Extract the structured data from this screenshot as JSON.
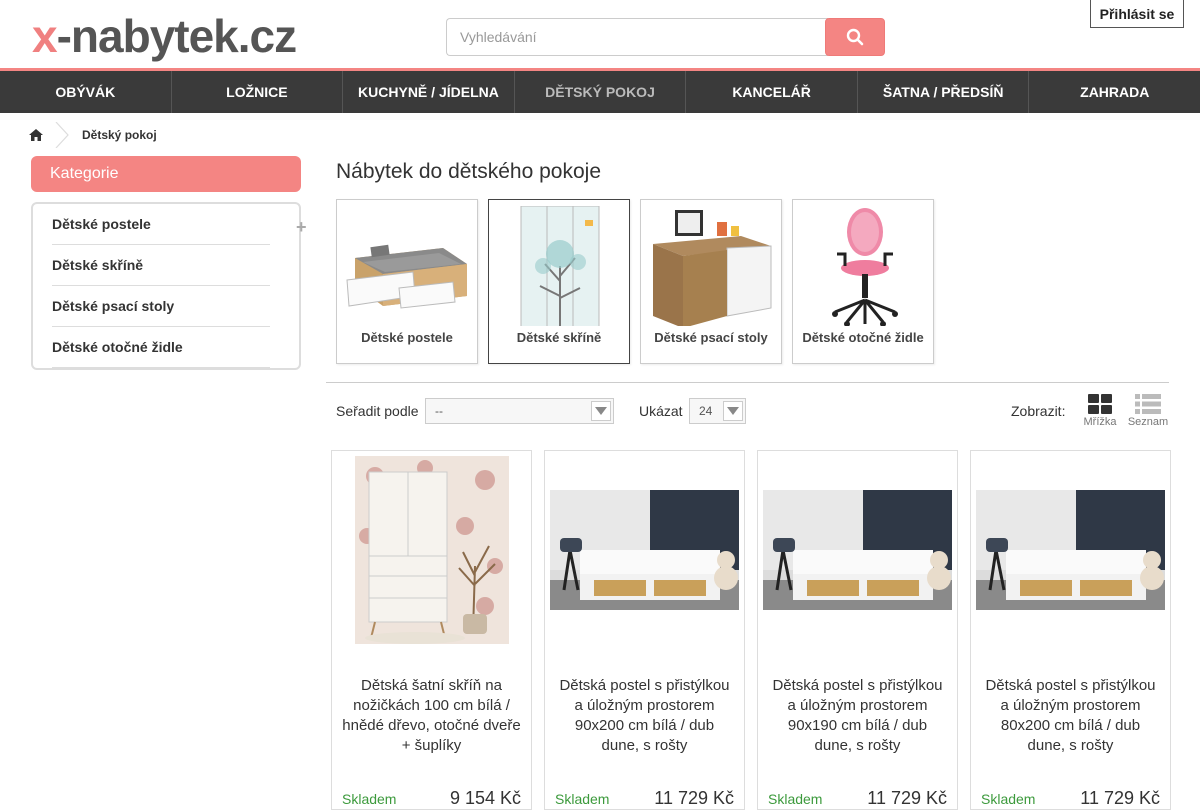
{
  "header": {
    "logo_x": "x",
    "logo_rest": "-nabytek.cz",
    "search_placeholder": "Vyhledávání",
    "login_label": "Přihlásit se"
  },
  "nav": [
    {
      "label": "OBÝVÁK"
    },
    {
      "label": "LOŽNICE"
    },
    {
      "label": "KUCHYNĚ / JÍDELNA"
    },
    {
      "label": "DĚTSKÝ POKOJ"
    },
    {
      "label": "KANCELÁŘ"
    },
    {
      "label": "ŠATNA / PŘEDSÍŇ"
    },
    {
      "label": "ZAHRADA"
    }
  ],
  "breadcrumb": {
    "current": "Dětský pokoj"
  },
  "sidebar": {
    "title": "Kategorie",
    "items": [
      {
        "label": "Dětské postele"
      },
      {
        "label": "Dětské skříně"
      },
      {
        "label": "Dětské psací stoly"
      },
      {
        "label": "Dětské otočné židle"
      }
    ]
  },
  "main": {
    "title": "Nábytek do dětského pokoje",
    "subcategories": [
      {
        "label": "Dětské postele"
      },
      {
        "label": "Dětské skříně"
      },
      {
        "label": "Dětské psací stoly"
      },
      {
        "label": "Dětské otočné židle"
      }
    ],
    "toolbar": {
      "sort_label": "Seřadit podle",
      "sort_value": "--",
      "show_label": "Ukázat",
      "show_value": "24",
      "display_label": "Zobrazit:",
      "grid_label": "Mřížka",
      "list_label": "Seznam"
    },
    "products": [
      {
        "name": "Dětská šatní skříň na nožičkách 100 cm bílá / hnědé dřevo, otočné dveře + šuplíky",
        "stock": "Skladem",
        "price": "9 154 Kč"
      },
      {
        "name": "Dětská postel s přistýlkou a úložným prostorem 90x200 cm bílá / dub dune, s rošty",
        "stock": "Skladem",
        "price": "11 729 Kč"
      },
      {
        "name": "Dětská postel s přistýlkou a úložným prostorem 90x190 cm bílá / dub dune, s rošty",
        "stock": "Skladem",
        "price": "11 729 Kč"
      },
      {
        "name": "Dětská postel s přistýlkou a úložným prostorem 80x200 cm bílá / dub dune, s rošty",
        "stock": "Skladem",
        "price": "11 729 Kč"
      }
    ]
  },
  "colors": {
    "accent": "#f48583",
    "nav_bg": "#3a3a3a",
    "stock_green": "#3c9a3c"
  }
}
